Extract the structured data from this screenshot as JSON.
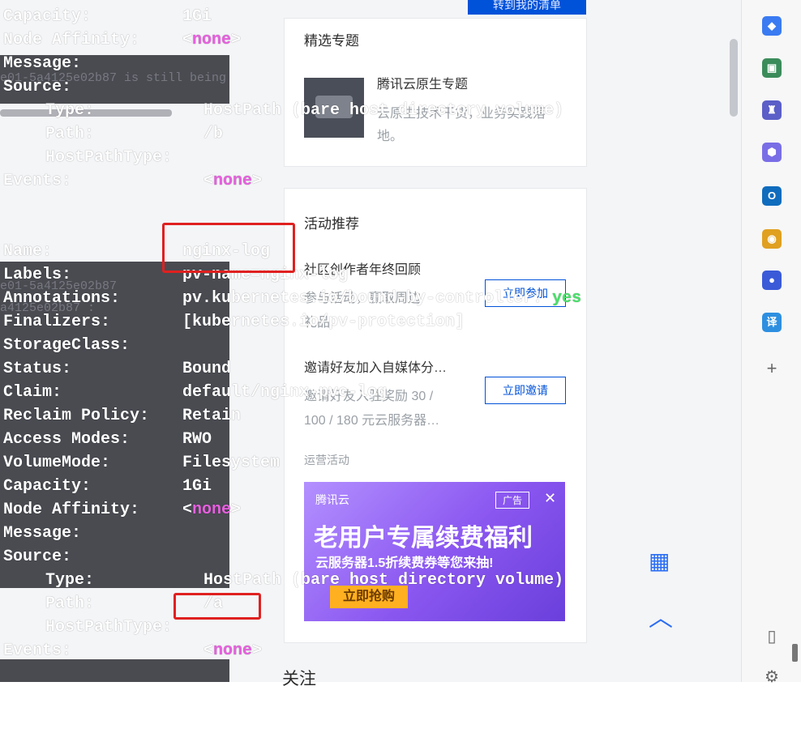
{
  "web": {
    "top_button": "转到我的清单",
    "featured": {
      "heading": "精选专题",
      "topic_title": "腾讯云原生专题",
      "topic_desc_line1": "云原生技术干货，业务实践落",
      "topic_desc_line2": "地。"
    },
    "activities": {
      "heading": "活动推荐",
      "item1_title": "社区创作者年终回顾",
      "item1_desc_line1": "参与活动，赢取周边",
      "item1_desc_line2": "礼品",
      "item1_button": "立即参加",
      "item2_title": "邀请好友加入自媒体分…",
      "item2_desc_line1": "邀请好友入驻奖励 30 /",
      "item2_desc_line2": "100 / 180 元云服务器…",
      "item2_button": "立即邀请"
    },
    "ops_label": "运营活动",
    "ad": {
      "logo": "腾讯云",
      "tag": "广告",
      "close": "✕",
      "title": "老用户专属续费福利",
      "subtitle": "云服务器1.5折续费券等您来抽!",
      "button": "立即抢购"
    },
    "follow_heading": "关注"
  },
  "terminal_ghost": {
    "g1": "e01-5a4125e02b87 is still being",
    "g2": "e01-5a4125e02b87",
    "g3": "a4125e02b87 :"
  },
  "terminal": {
    "pv1": {
      "capacity_key": "Capacity:",
      "capacity_val": "1Gi",
      "affinity_key": "Node Affinity:",
      "affinity_open": "<",
      "affinity_val": "none",
      "affinity_close": ">",
      "message_key": "Message:",
      "source_key": "Source:",
      "type_key": "Type:",
      "type_val": "HostPath (bare host directory volume)",
      "path_key": "Path:",
      "path_val": "/b",
      "hostpathtype_key": "HostPathType:",
      "events_key": "Events:",
      "events_open": "<",
      "events_val": "none",
      "events_close": ">"
    },
    "pv2": {
      "name_key": "Name:",
      "name_val": "nginx-log",
      "labels_key": "Labels:",
      "labels_val": "pv-name=nginx-log",
      "annotations_key": "Annotations:",
      "annotations_val": "pv.kubernetes.io/bound-by-controller:",
      "annotations_flag": "yes",
      "finalizers_key": "Finalizers:",
      "finalizers_val": "[kubernetes.io/pv-protection]",
      "storageclass_key": "StorageClass:",
      "status_key": "Status:",
      "status_val": "Bound",
      "claim_key": "Claim:",
      "claim_val": "default/nginx-pvc-log",
      "reclaim_key": "Reclaim Policy:",
      "reclaim_val": "Retain",
      "access_key": "Access Modes:",
      "access_val": "RWO",
      "volumemode_key": "VolumeMode:",
      "volumemode_val": "Filesystem",
      "capacity_key": "Capacity:",
      "capacity_val": "1Gi",
      "affinity_key": "Node Affinity:",
      "affinity_open": "<",
      "affinity_val": "none",
      "affinity_close": ">",
      "message_key": "Message:",
      "source_key": "Source:",
      "type_key": "Type:",
      "type_val": "HostPath (bare host directory volume)",
      "path_key": "Path:",
      "path_val": "/a",
      "hostpathtype_key": "HostPathType:",
      "events_key": "Events:",
      "events_open": "<",
      "events_val": "none",
      "events_close": ">"
    }
  },
  "toolbar_icons": [
    "tag-icon",
    "toolbox-icon",
    "chess-icon",
    "hexagon-icon",
    "outlook-icon",
    "chrome-icon",
    "baidu-paw-icon",
    "translate-icon",
    "add-icon",
    "sidebar-toggle-icon",
    "settings-icon"
  ],
  "toolbar_glyphs": {
    "tag": "◆",
    "toolbox": "▣",
    "chess": "♜",
    "hexagon": "⬢",
    "outlook": "O",
    "chrome": "◉",
    "paw": "●",
    "translate": "译",
    "plus": "+",
    "sidebar": "▯",
    "gear": "⚙",
    "qr": "▦",
    "up": "︿"
  },
  "colors": {
    "terminal_text": "#ffffff",
    "terminal_magenta": "#e85fe0",
    "terminal_green": "#49e06a",
    "highlight_red": "#e02020",
    "brand_blue": "#0052d9"
  }
}
